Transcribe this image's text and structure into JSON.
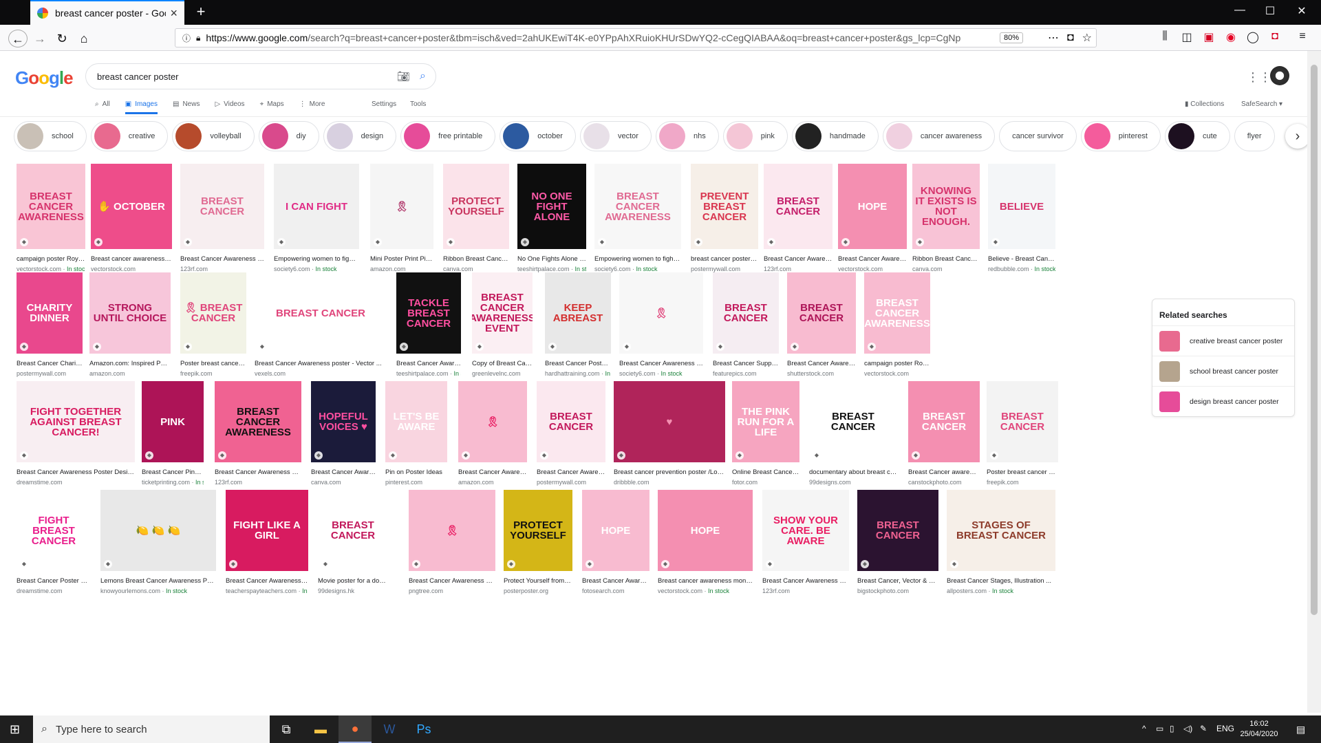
{
  "browser": {
    "tab_title": "breast cancer poster - Google S",
    "url_host": "https://www.google.com",
    "url_rest": "/search?q=breast+cancer+poster&tbm=isch&ved=2ahUKEwiT4K-e0YPpAhXRuioKHUrSDwYQ2-cCegQIABAA&oq=breast+cancer+poster&gs_lcp=CgNp",
    "zoom": "80%"
  },
  "google": {
    "logo": "Google",
    "query": "breast cancer poster",
    "verticals": [
      {
        "icon": "⌕",
        "label": "All"
      },
      {
        "icon": "▣",
        "label": "Images"
      },
      {
        "icon": "▤",
        "label": "News"
      },
      {
        "icon": "▷",
        "label": "Videos"
      },
      {
        "icon": "⌖",
        "label": "Maps"
      },
      {
        "icon": "⋮",
        "label": "More"
      }
    ],
    "settings": "Settings",
    "tools": "Tools",
    "collections": "Collections",
    "safesearch": "SafeSearch ▾"
  },
  "chips": [
    {
      "label": "school",
      "color": "#c9c0b6"
    },
    {
      "label": "creative",
      "color": "#e86a8f"
    },
    {
      "label": "volleyball",
      "color": "#b64b2c"
    },
    {
      "label": "diy",
      "color": "#d94a8c"
    },
    {
      "label": "design",
      "color": "#d8d0e0"
    },
    {
      "label": "free printable",
      "color": "#e64c99"
    },
    {
      "label": "october",
      "color": "#2c5aa0"
    },
    {
      "label": "vector",
      "color": "#e8e0e8"
    },
    {
      "label": "nhs",
      "color": "#f0a8c8"
    },
    {
      "label": "pink",
      "color": "#f4c6d6"
    },
    {
      "label": "handmade",
      "color": "#222222"
    },
    {
      "label": "cancer awareness",
      "color": "#f0d0e0"
    },
    {
      "label": "cancer survivor",
      "color": ""
    },
    {
      "label": "pinterest",
      "color": "#f45c9c"
    },
    {
      "label": "cute",
      "color": "#1d1020"
    },
    {
      "label": "flyer",
      "color": ""
    }
  ],
  "rows": [
    [
      {
        "caption": "campaign poster Royalty...",
        "source": "vectorstock.com",
        "stock": "In stock",
        "bg": "#f9c5d5",
        "fg": "#d6336c",
        "text": "BREAST CANCER Awareness"
      },
      {
        "caption": "Breast cancer awareness mo...",
        "source": "vectorstock.com",
        "stock": "",
        "bg": "#ee4d8a",
        "fg": "#ffffff",
        "text": "✋ OCTOBER"
      },
      {
        "caption": "Breast Cancer Awareness Pink...",
        "source": "123rf.com",
        "stock": "",
        "bg": "#f7eef0",
        "fg": "#e06a92",
        "text": "BREAST CANCER"
      },
      {
        "caption": "Empowering women to fight bre...",
        "source": "society6.com",
        "stock": "In stock",
        "bg": "#f0f0f0",
        "fg": "#e02c86",
        "text": "I CAN FIGHT"
      },
      {
        "caption": "Mini Poster Print Pink ...",
        "source": "amazon.com",
        "stock": "",
        "bg": "#f5f5f5",
        "fg": "#b0366a",
        "text": "🎗"
      },
      {
        "caption": "Ribbon Breast Cancer ...",
        "source": "canva.com",
        "stock": "",
        "bg": "#fbe3ea",
        "fg": "#c9355f",
        "text": "PROTECT YOURSELF"
      },
      {
        "caption": "No One Fights Alone Bre...",
        "source": "teeshirtpalace.com",
        "stock": "In sto...",
        "bg": "#0d0d0d",
        "fg": "#ff5aa8",
        "text": "NO ONE FIGHT ALONE"
      },
      {
        "caption": "Empowering women to fight bre...",
        "source": "society6.com",
        "stock": "In stock",
        "bg": "#f7f7f7",
        "fg": "#e06a92",
        "text": "BREAST CANCER AWARENESS"
      },
      {
        "caption": "breast cancer poster te...",
        "source": "postermywall.com",
        "stock": "",
        "bg": "#f6efe8",
        "fg": "#d9364f",
        "text": "PREVENT BREAST CANCER"
      },
      {
        "caption": "Breast Cancer Awarene...",
        "source": "123rf.com",
        "stock": "",
        "bg": "#fbe8ef",
        "fg": "#c41e6a",
        "text": "breast cancer"
      },
      {
        "caption": "Breast Cancer Awarene...",
        "source": "vectorstock.com",
        "stock": "",
        "bg": "#f48fb1",
        "fg": "#ffffff",
        "text": "HOPE"
      },
      {
        "caption": "Ribbon Breast Cancer ...",
        "source": "canva.com",
        "stock": "",
        "bg": "#f8c3d6",
        "fg": "#d6336c",
        "text": "KNOWING IT EXISTS IS NOT ENOUGH."
      },
      {
        "caption": "Believe - Breast Cancer ...",
        "source": "redbubble.com",
        "stock": "In stock",
        "bg": "#f4f6f8",
        "fg": "#d6336c",
        "text": "Believe"
      }
    ],
    [
      {
        "caption": "Breast Cancer Charity T...",
        "source": "postermywall.com",
        "stock": "",
        "bg": "#e9488d",
        "fg": "#ffffff",
        "text": "CHARITY DINNER"
      },
      {
        "caption": "Amazon.com: Inspired Poster...",
        "source": "amazon.com",
        "stock": "",
        "bg": "#f7c6da",
        "fg": "#b5175c",
        "text": "STRONG UNTIL CHOICE"
      },
      {
        "caption": "Poster breast cancer a...",
        "source": "freepik.com",
        "stock": "",
        "bg": "#f2f3e6",
        "fg": "#e0457b",
        "text": "🎗 BREAST CANCER"
      },
      {
        "caption": "Breast Cancer Awareness poster - Vector ...",
        "source": "vexels.com",
        "stock": "",
        "bg": "#ffffff",
        "fg": "#e0457b",
        "text": "BREAST CANCER"
      },
      {
        "caption": "Breast Cancer Awarene...",
        "source": "teeshirtpalace.com",
        "stock": "In st...",
        "bg": "#111111",
        "fg": "#ff4fa0",
        "text": "TACKLE BREAST CANCER"
      },
      {
        "caption": "Copy of Breast Cancer ...",
        "source": "greenlevelnc.com",
        "stock": "",
        "bg": "#fbeff3",
        "fg": "#c2185b",
        "text": "Breast Cancer Awareness Event"
      },
      {
        "caption": "Breast Cancer Poster | ...",
        "source": "hardhattraining.com",
        "stock": "In s...",
        "bg": "#e8e8e8",
        "fg": "#d32f2f",
        "text": "KEEP ABREAST"
      },
      {
        "caption": "Breast Cancer Awareness Pink...",
        "source": "society6.com",
        "stock": "In stock",
        "bg": "#f7f7f7",
        "fg": "#e0457b",
        "text": "🎗"
      },
      {
        "caption": "Breast Cancer Support ...",
        "source": "featurepics.com",
        "stock": "",
        "bg": "#f5edf2",
        "fg": "#c2185b",
        "text": "breast cancer"
      },
      {
        "caption": "Breast Cancer Awarene...",
        "source": "shutterstock.com",
        "stock": "",
        "bg": "#f8bbd0",
        "fg": "#ad1457",
        "text": "BREAST Cancer"
      },
      {
        "caption": "campaign poster Royalt...",
        "source": "vectorstock.com",
        "stock": "",
        "bg": "#f8bbd0",
        "fg": "#ffffff",
        "text": "Breast CANCER Awareness"
      }
    ],
    [
      {
        "caption": "Breast Cancer Awareness Poster Design ...",
        "source": "dreamstime.com",
        "stock": "",
        "bg": "#f8eef2",
        "fg": "#d81b60",
        "text": "Fight together against breast cancer!"
      },
      {
        "caption": "Breast Cancer Pink Rib...",
        "source": "ticketprinting.com",
        "stock": "In sto...",
        "bg": "#ad1457",
        "fg": "#ffffff",
        "text": "PINK"
      },
      {
        "caption": "Breast Cancer Awareness Calligr...",
        "source": "123rf.com",
        "stock": "",
        "bg": "#f06292",
        "fg": "#111111",
        "text": "Breast CANCER awareness"
      },
      {
        "caption": "Breast Cancer Awarene...",
        "source": "canva.com",
        "stock": "",
        "bg": "#1b1b3a",
        "fg": "#ff4fa0",
        "text": "HOPEFUL VOICES ♥"
      },
      {
        "caption": "Pin on Poster Ideas",
        "source": "pinterest.com",
        "stock": "",
        "bg": "#f9d5e0",
        "fg": "#ffffff",
        "text": "LET'S BE AWARE"
      },
      {
        "caption": "Breast Cancer Awarenes...",
        "source": "amazon.com",
        "stock": "",
        "bg": "#f8bbd0",
        "fg": "#e91e63",
        "text": "🎗"
      },
      {
        "caption": "Breast Cancer Awarene...",
        "source": "postermywall.com",
        "stock": "",
        "bg": "#fbe8ef",
        "fg": "#c2185b",
        "text": "BREAST CANCER"
      },
      {
        "caption": "Breast cancer prevention poster /Love ...",
        "source": "dribbble.com",
        "stock": "",
        "bg": "#b0245a",
        "fg": "#f48fb1",
        "text": "♥"
      },
      {
        "caption": "Online Breast Cancer Po...",
        "source": "fotor.com",
        "stock": "",
        "bg": "#f6a5c0",
        "fg": "#ffffff",
        "text": "The Pink Run for a Life"
      },
      {
        "caption": "documentary about breast canc...",
        "source": "99designs.com",
        "stock": "",
        "bg": "#ffffff",
        "fg": "#111111",
        "text": "BREAST CANCER"
      },
      {
        "caption": "Breast Cancer awareness...",
        "source": "canstockphoto.com",
        "stock": "",
        "bg": "#f48fb1",
        "fg": "#ffffff",
        "text": "Breast Cancer"
      },
      {
        "caption": "Poster breast cancer awa...",
        "source": "freepik.com",
        "stock": "",
        "bg": "#f3f3f3",
        "fg": "#e0457b",
        "text": "BREAST CANCER"
      }
    ],
    [
      {
        "caption": "Breast Cancer Poster With Pi...",
        "source": "dreamstime.com",
        "stock": "",
        "bg": "#ffffff",
        "fg": "#e91e8c",
        "text": "FIGHT Breast Cancer"
      },
      {
        "caption": "Lemons Breast Cancer Awareness Poster ...",
        "source": "knowyourlemons.com",
        "stock": "In stock",
        "bg": "#e8e8e8",
        "fg": "#333333",
        "text": "🍋 🍋 🍋"
      },
      {
        "caption": "Breast Cancer Awareness Pos...",
        "source": "teacherspayteachers.com",
        "stock": "In stock",
        "bg": "#d81b60",
        "fg": "#ffffff",
        "text": "FIGHT LIKE A Girl"
      },
      {
        "caption": "Movie poster for a documenta...",
        "source": "99designs.hk",
        "stock": "",
        "bg": "#ffffff",
        "fg": "#c2185b",
        "text": "BREAST CANCER"
      },
      {
        "caption": "Breast Cancer Awareness Mont...",
        "source": "pngtree.com",
        "stock": "",
        "bg": "#f8bbd0",
        "fg": "#e91e63",
        "text": "🎗"
      },
      {
        "caption": "Protect Yourself from Br...",
        "source": "posterposter.org",
        "stock": "",
        "bg": "#d4b617",
        "fg": "#111111",
        "text": "PROTECT YOURSELF"
      },
      {
        "caption": "Breast Cancer Awarene...",
        "source": "fotosearch.com",
        "stock": "",
        "bg": "#f8bbd0",
        "fg": "#ffffff",
        "text": "HOPE"
      },
      {
        "caption": "Breast cancer awareness month p...",
        "source": "vectorstock.com",
        "stock": "In stock",
        "bg": "#f48fb1",
        "fg": "#ffffff",
        "text": "HOPE"
      },
      {
        "caption": "Breast Cancer Awareness Post...",
        "source": "123rf.com",
        "stock": "",
        "bg": "#f5f5f5",
        "fg": "#e91e63",
        "text": "SHOW YOUR CARE. BE AWARE"
      },
      {
        "caption": "Breast Cancer, Vector & Phot...",
        "source": "bigstockphoto.com",
        "stock": "",
        "bg": "#2b1330",
        "fg": "#f06292",
        "text": "BREAST CANCER"
      },
      {
        "caption": "Breast Cancer Stages, Illustration ...",
        "source": "allposters.com",
        "stock": "In stock",
        "bg": "#f6efe8",
        "fg": "#8d3b2a",
        "text": "Stages of Breast Cancer"
      }
    ]
  ],
  "related": {
    "title": "Related searches",
    "items": [
      {
        "label": "creative breast cancer poster",
        "color": "#e86a8f"
      },
      {
        "label": "school breast cancer poster",
        "color": "#b5a48e"
      },
      {
        "label": "design breast cancer poster",
        "color": "#e64c99"
      }
    ]
  },
  "taskbar": {
    "search_placeholder": "Type here to search",
    "lang": "ENG",
    "time": "16:02",
    "date": "25/04/2020"
  }
}
